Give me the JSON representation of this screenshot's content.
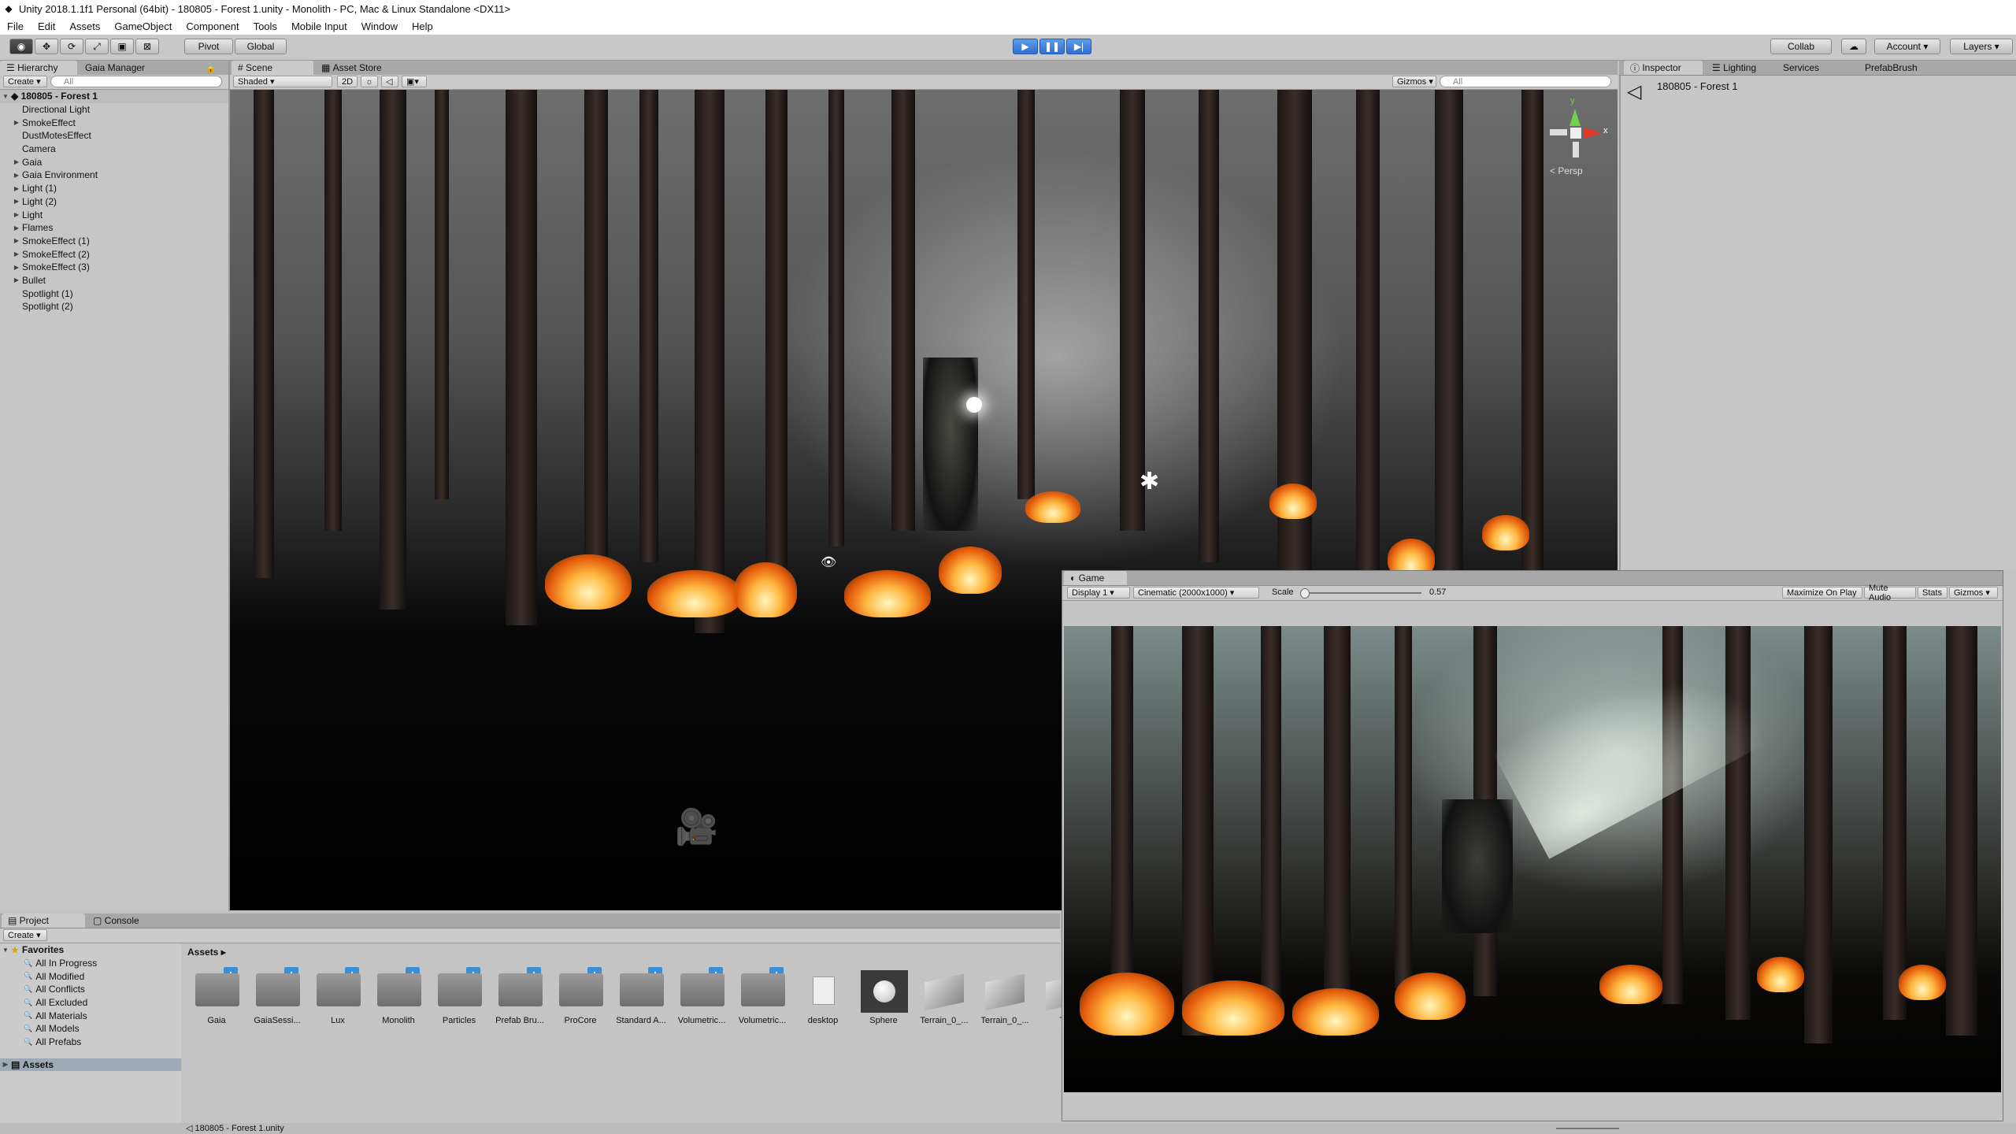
{
  "window": {
    "title": "Unity 2018.1.1f1 Personal (64bit) - 180805 - Forest 1.unity - Monolith - PC, Mac & Linux Standalone <DX11>"
  },
  "menu": [
    "File",
    "Edit",
    "Assets",
    "GameObject",
    "Component",
    "Tools",
    "Mobile Input",
    "Window",
    "Help"
  ],
  "toolbar": {
    "pivot": "Pivot",
    "global": "Global",
    "collab": "Collab",
    "account": "Account",
    "layers": "Layers"
  },
  "hierarchy": {
    "tab": "Hierarchy",
    "tab2": "Gaia Manager",
    "create": "Create",
    "search": "All",
    "scene": "180805 - Forest 1",
    "items": [
      {
        "label": "Directional Light",
        "arrow": false
      },
      {
        "label": "SmokeEffect",
        "arrow": true
      },
      {
        "label": "DustMotesEffect",
        "arrow": false
      },
      {
        "label": "Camera",
        "arrow": false
      },
      {
        "label": "Gaia",
        "arrow": true
      },
      {
        "label": "Gaia Environment",
        "arrow": true
      },
      {
        "label": "Light (1)",
        "arrow": true
      },
      {
        "label": "Light (2)",
        "arrow": true
      },
      {
        "label": "Light",
        "arrow": true
      },
      {
        "label": "Flames",
        "arrow": true
      },
      {
        "label": "SmokeEffect (1)",
        "arrow": true
      },
      {
        "label": "SmokeEffect (2)",
        "arrow": true
      },
      {
        "label": "SmokeEffect (3)",
        "arrow": true
      },
      {
        "label": "Bullet",
        "arrow": true
      },
      {
        "label": "Spotlight (1)",
        "arrow": false
      },
      {
        "label": "Spotlight (2)",
        "arrow": false
      }
    ]
  },
  "scene": {
    "tab": "Scene",
    "tab2": "Asset Store",
    "shading": "Shaded",
    "mode2d": "2D",
    "gizmos": "Gizmos",
    "search": "All",
    "persp": "< Persp",
    "axis_y": "y",
    "axis_x": "x"
  },
  "inspector": {
    "tab": "Inspector",
    "tab2": "Lighting",
    "tab3": "Services",
    "tab4": "PrefabBrush",
    "object": "180805 - Forest 1"
  },
  "game": {
    "tab": "Game",
    "display": "Display 1",
    "aspect": "Cinematic (2000x1000)",
    "scale_label": "Scale",
    "scale_value": "0.57",
    "maximize": "Maximize On Play",
    "mute": "Mute Audio",
    "stats": "Stats",
    "gizmos": "Gizmos"
  },
  "project": {
    "tab": "Project",
    "tab2": "Console",
    "create": "Create",
    "favorites": "Favorites",
    "fav_items": [
      "All In Progress",
      "All Modified",
      "All Conflicts",
      "All Excluded",
      "All Materials",
      "All Models",
      "All Prefabs"
    ],
    "assets_root": "Assets",
    "breadcrumb": "Assets",
    "assets": [
      {
        "label": "Gaia",
        "kind": "folder"
      },
      {
        "label": "GaiaSessi...",
        "kind": "folder"
      },
      {
        "label": "Lux",
        "kind": "folder"
      },
      {
        "label": "Monolith",
        "kind": "folder"
      },
      {
        "label": "Particles",
        "kind": "folder"
      },
      {
        "label": "Prefab Bru...",
        "kind": "folder"
      },
      {
        "label": "ProCore",
        "kind": "folder"
      },
      {
        "label": "Standard A...",
        "kind": "folder"
      },
      {
        "label": "Volumetric...",
        "kind": "folder"
      },
      {
        "label": "Volumetric...",
        "kind": "folder"
      },
      {
        "label": "desktop",
        "kind": "file"
      },
      {
        "label": "Sphere",
        "kind": "sphere"
      },
      {
        "label": "Terrain_0_...",
        "kind": "terrain"
      },
      {
        "label": "Terrain_0_...",
        "kind": "terrain"
      },
      {
        "label": "Ter",
        "kind": "terrain"
      }
    ]
  },
  "status": {
    "file": "180805 - Forest 1.unity"
  }
}
